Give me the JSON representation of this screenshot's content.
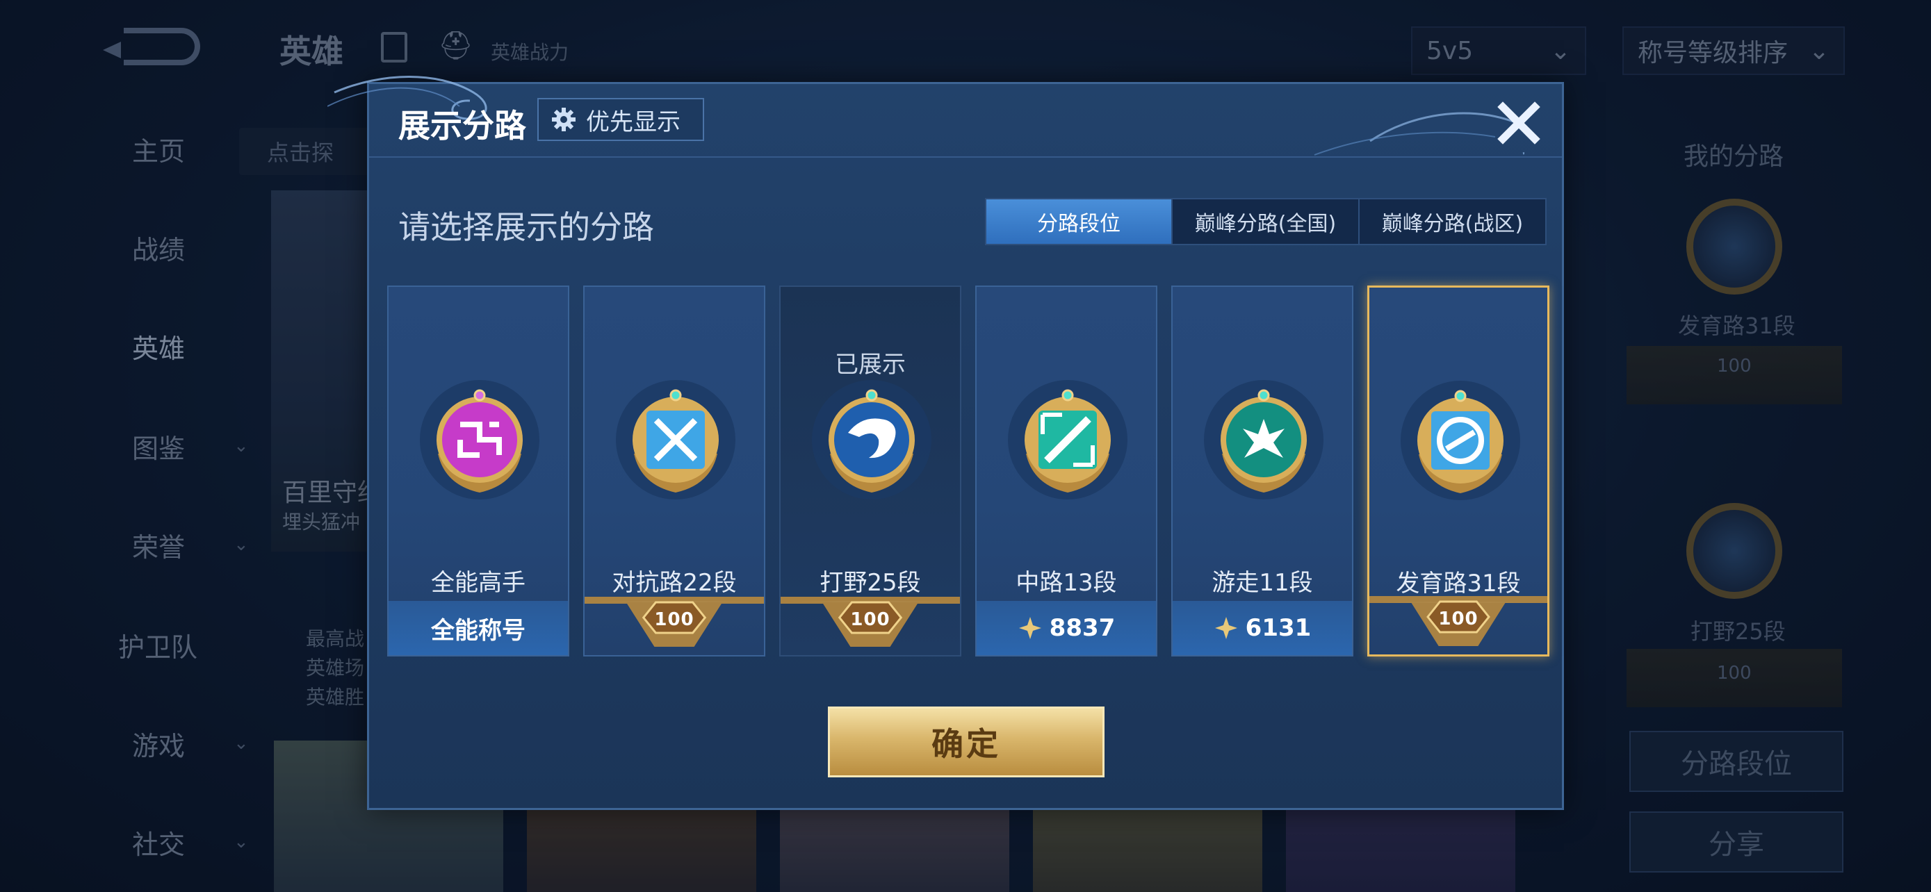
{
  "background": {
    "nav": [
      "主页",
      "战绩",
      "英雄",
      "图鉴",
      "荣誉",
      "护卫队",
      "游戏",
      "社交"
    ],
    "title": "英雄",
    "power_label": "英雄战力",
    "mode_select": "5v5",
    "sort_select": "称号等级排序",
    "search_placeholder": "点击探",
    "hero_name": "百里守约",
    "hero_sub": "埋头猛冲",
    "stats": [
      "最高战",
      "英雄场",
      "英雄胜"
    ],
    "right_panel": {
      "title": "我的分路",
      "lane_1": "发育路31段",
      "lane_1_badge": "100",
      "lane_2": "打野25段",
      "lane_2_badge": "100",
      "btn_lane": "分路段位",
      "btn_share": "分享"
    }
  },
  "modal": {
    "title": "展示分路",
    "priority_label": "优先显示",
    "subtitle": "请选择展示的分路",
    "tabs": [
      "分路段位",
      "巅峰分路(全国)",
      "巅峰分路(战区)"
    ],
    "active_tab": 0,
    "shown_label": "已展示",
    "cards": [
      {
        "name": "全能高手",
        "bottom": "全能称号",
        "kind": "text"
      },
      {
        "name": "对抗路22段",
        "bottom": "100",
        "kind": "ribbon"
      },
      {
        "name": "打野25段",
        "bottom": "100",
        "kind": "ribbon",
        "shown": true
      },
      {
        "name": "中路13段",
        "bottom": "8837",
        "kind": "score"
      },
      {
        "name": "游走11段",
        "bottom": "6131",
        "kind": "score"
      },
      {
        "name": "发育路31段",
        "bottom": "100",
        "kind": "ribbon",
        "selected": true
      }
    ],
    "confirm_label": "确定"
  },
  "colors": {
    "gold": "#e7b95d",
    "modal_bg": "#22426b",
    "tab_active": "#3f83cf",
    "all_round_emblem": "#c63bc9",
    "lane_emblem_blue": "#3fa6e6",
    "lane_emblem_teal": "#1fb8a2"
  },
  "icons": {
    "gear": "gear-icon",
    "close": "close-icon",
    "score": "peak-score-icon"
  }
}
